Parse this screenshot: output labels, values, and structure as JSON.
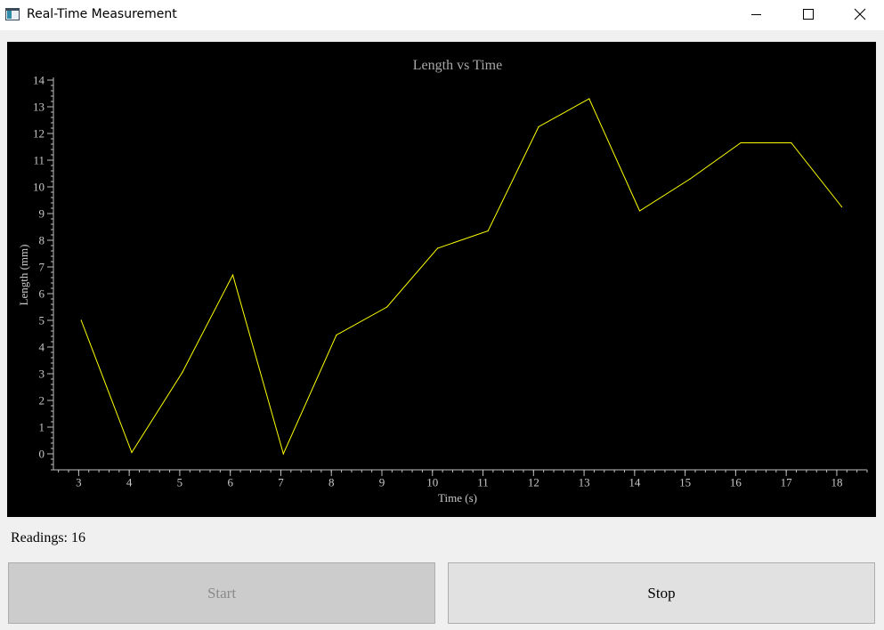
{
  "window": {
    "title": "Real-Time Measurement",
    "controls": [
      "minimize-icon",
      "maximize-icon",
      "close-icon"
    ]
  },
  "chart_data": {
    "type": "line",
    "title": "Length vs Time",
    "xlabel": "Time (s)",
    "ylabel": "Length (mm)",
    "xlim": [
      2.5,
      18.6
    ],
    "ylim": [
      -0.6,
      14.1
    ],
    "xticks": [
      3,
      4,
      5,
      6,
      7,
      8,
      9,
      10,
      11,
      12,
      13,
      14,
      15,
      16,
      17,
      18
    ],
    "yticks": [
      0,
      1,
      2,
      3,
      4,
      5,
      6,
      7,
      8,
      9,
      10,
      11,
      12,
      13,
      14
    ],
    "grid": false,
    "background": "#000000",
    "axis_color": "#c0c0c0",
    "series": [
      {
        "color": "#ffff00",
        "x": [
          3.05,
          4.05,
          5.05,
          6.05,
          7.05,
          8.1,
          9.1,
          10.1,
          11.1,
          12.1,
          13.1,
          14.1,
          15.1,
          16.1,
          17.1,
          18.1
        ],
        "y": [
          5.0,
          0.05,
          3.05,
          6.7,
          0.0,
          4.45,
          5.5,
          7.7,
          8.35,
          12.25,
          13.3,
          9.1,
          10.3,
          11.65,
          11.65,
          9.25
        ]
      }
    ]
  },
  "status": {
    "readings_text": "Readings: 16"
  },
  "buttons": {
    "start_label": "Start",
    "stop_label": "Stop"
  }
}
